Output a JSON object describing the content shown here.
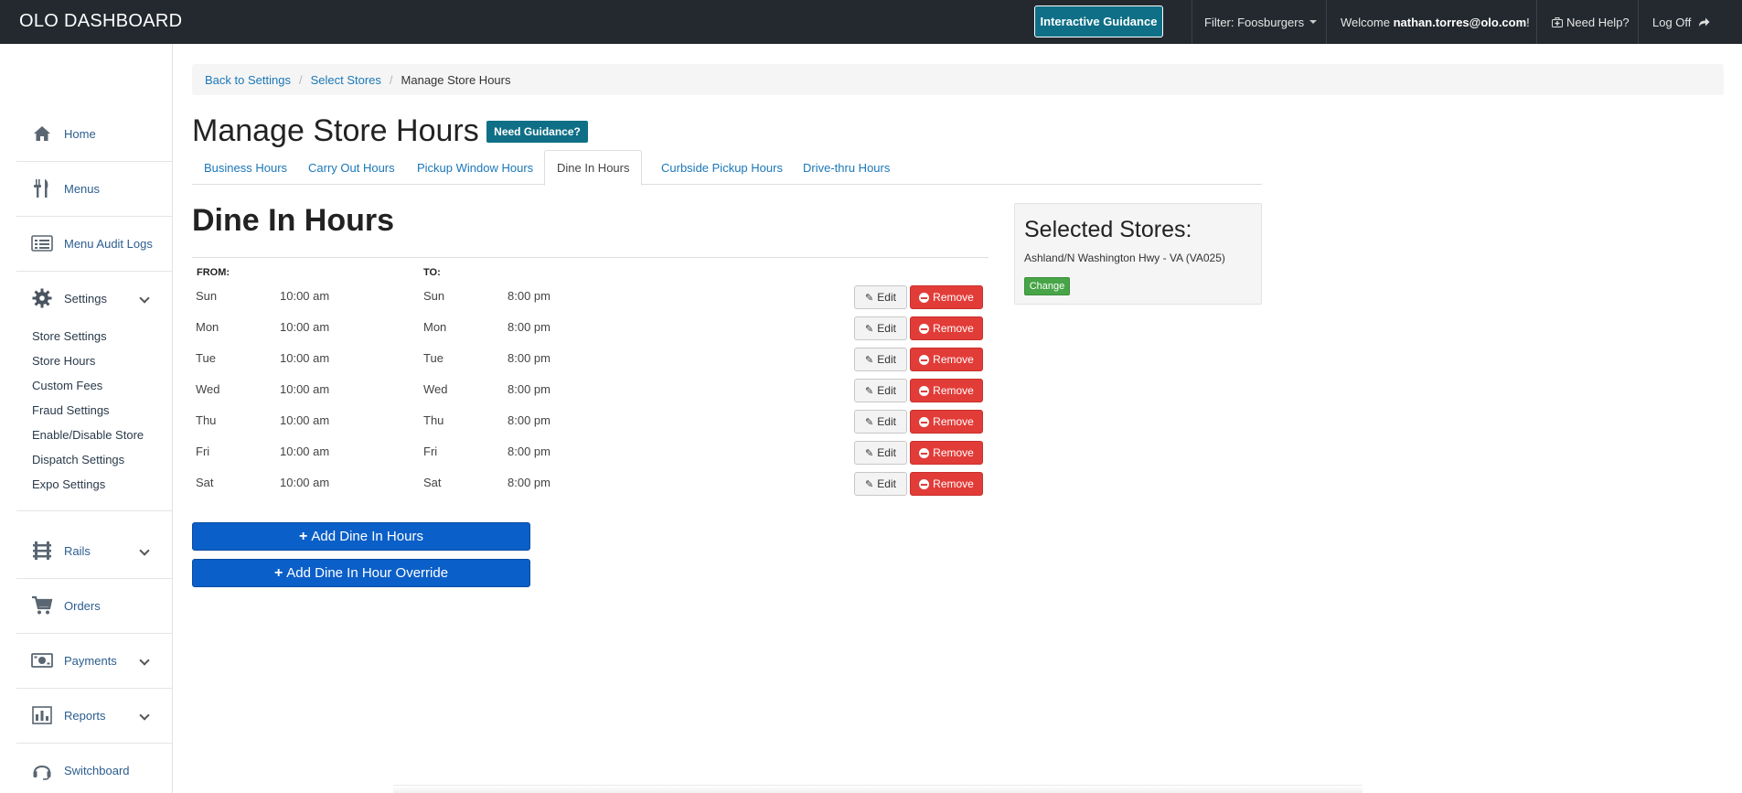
{
  "app": {
    "brand": "OLO DASHBOARD"
  },
  "topbar": {
    "guidance_label": "Interactive Guidance",
    "filter_label": "Filter: Foosburgers",
    "welcome_prefix": "Welcome ",
    "welcome_user": "nathan.torres@olo.com",
    "welcome_suffix": "!",
    "help_label": "Need Help?",
    "logoff_label": "Log Off"
  },
  "sidebar": {
    "items": [
      {
        "label": "Home",
        "icon": "home-icon"
      },
      {
        "label": "Menus",
        "icon": "fork-knife-icon"
      },
      {
        "label": "Menu Audit Logs",
        "icon": "list-icon"
      },
      {
        "label": "Settings",
        "icon": "gear-icon"
      },
      {
        "label": "Rails",
        "icon": "rails-icon"
      },
      {
        "label": "Orders",
        "icon": "cart-icon"
      },
      {
        "label": "Payments",
        "icon": "money-icon"
      },
      {
        "label": "Reports",
        "icon": "bar-chart-icon"
      },
      {
        "label": "Switchboard",
        "icon": "headset-icon"
      }
    ],
    "settings_sub": [
      "Store Settings",
      "Store Hours",
      "Custom Fees",
      "Fraud Settings",
      "Enable/Disable Store",
      "Dispatch Settings",
      "Expo Settings"
    ]
  },
  "breadcrumb": {
    "items": [
      "Back to Settings",
      "Select Stores"
    ],
    "current": "Manage Store Hours"
  },
  "page": {
    "title": "Manage Store Hours",
    "guidance_btn": "Need Guidance?"
  },
  "tabs": [
    "Business Hours",
    "Carry Out Hours",
    "Pickup Window Hours",
    "Dine In Hours",
    "Curbside Pickup Hours",
    "Drive-thru Hours"
  ],
  "active_tab": "Dine In Hours",
  "section": {
    "title": "Dine In Hours",
    "from_label": "FROM:",
    "to_label": "TO:",
    "edit_label": "Edit",
    "remove_label": "Remove",
    "rows": [
      {
        "from_day": "Sun",
        "from_time": "10:00 am",
        "to_day": "Sun",
        "to_time": "8:00 pm"
      },
      {
        "from_day": "Mon",
        "from_time": "10:00 am",
        "to_day": "Mon",
        "to_time": "8:00 pm"
      },
      {
        "from_day": "Tue",
        "from_time": "10:00 am",
        "to_day": "Tue",
        "to_time": "8:00 pm"
      },
      {
        "from_day": "Wed",
        "from_time": "10:00 am",
        "to_day": "Wed",
        "to_time": "8:00 pm"
      },
      {
        "from_day": "Thu",
        "from_time": "10:00 am",
        "to_day": "Thu",
        "to_time": "8:00 pm"
      },
      {
        "from_day": "Fri",
        "from_time": "10:00 am",
        "to_day": "Fri",
        "to_time": "8:00 pm"
      },
      {
        "from_day": "Sat",
        "from_time": "10:00 am",
        "to_day": "Sat",
        "to_time": "8:00 pm"
      }
    ],
    "add_hours_label": "Add Dine In Hours",
    "add_override_label": "Add Dine In Hour Override"
  },
  "stores": {
    "title": "Selected Stores:",
    "name": "Ashland/N Washington Hwy - VA (VA025)",
    "change_label": "Change"
  },
  "colors": {
    "topbar": "#23292f",
    "accent": "#0f6f86",
    "link": "#1b77b8",
    "primary": "#0b5fc8",
    "danger": "#e23c38",
    "success": "#47a447"
  }
}
